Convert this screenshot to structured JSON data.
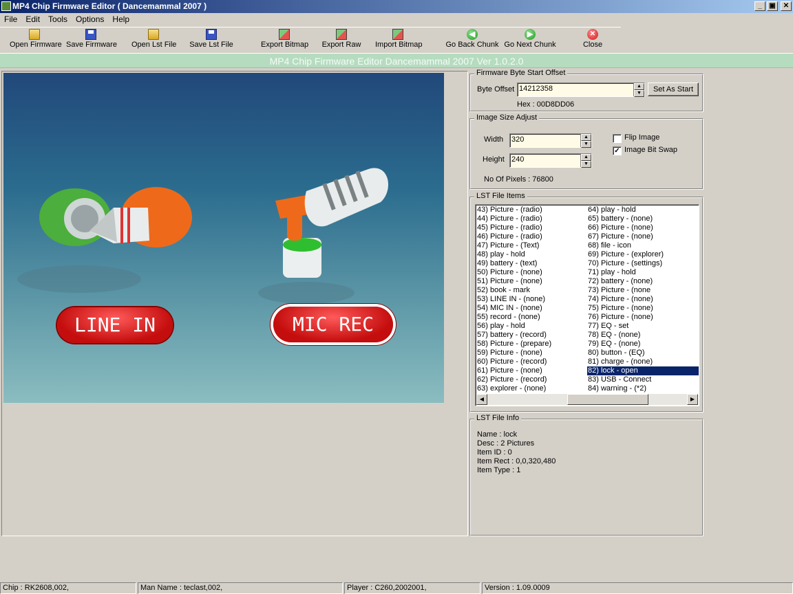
{
  "window": {
    "title": "MP4 Chip Firmware Editor ( Dancemammal 2007 )",
    "min": "_",
    "max": "▣",
    "close": "✕"
  },
  "menu": [
    "File",
    "Edit",
    "Tools",
    "Options",
    "Help"
  ],
  "toolbar": {
    "open_firmware": "Open Firmware",
    "save_firmware": "Save Firmware",
    "open_lst": "Open Lst File",
    "save_lst": "Save Lst File",
    "export_bitmap": "Export Bitmap",
    "export_raw": "Export Raw",
    "import_bitmap": "Import Bitmap",
    "go_back": "Go Back Chunk",
    "go_next": "Go Next Chunk",
    "close": "Close"
  },
  "banner": "MP4 Chip Firmware Editor Dancemammal 2007 Ver 1.0.2.0",
  "preview": {
    "line_in": "LINE IN",
    "mic_rec": "MIC REC"
  },
  "offset_group": {
    "title": "Firmware Byte Start Offset",
    "label": "Byte Offset",
    "value": "14212358",
    "set_button": "Set As Start",
    "hex": "Hex : 00D8DD06"
  },
  "size_group": {
    "title": "Image Size Adjust",
    "width_label": "Width",
    "width_value": "320",
    "height_label": "Height",
    "height_value": "240",
    "pixels": "No Of Pixels : 76800",
    "flip_label": "Flip Image",
    "flip_checked": false,
    "swap_label": "Image Bit Swap",
    "swap_checked": true
  },
  "lst_items": {
    "title": "LST File Items",
    "col1": [
      "43)  Picture - (radio)",
      "44)  Picture - (radio)",
      "45)  Picture - (radio)",
      "46)  Picture - (radio)",
      "47)  Picture - (Text)",
      "48)  play - hold",
      "49)  battery - (text)",
      "50)  Picture - (none)",
      "51)  Picture - (none)",
      "52)  book - mark",
      "53)  LINE IN - (none)",
      "54)  MIC IN - (none)",
      "55)  record - (none)",
      "56)  play - hold",
      "57)  battery - (record)",
      "58)  Picture - (prepare)",
      "59)  Picture - (none)",
      "60)  Picture - (record)",
      "61)  Picture - (none)",
      "62)  Picture - (record)",
      "63)  explorer - (none)"
    ],
    "col2": [
      "64)  play - hold",
      "65)  battery - (none)",
      "66)  Picture - (none)",
      "67)  Picture - (none)",
      "68)  file - icon",
      "69)  Picture - (explorer)",
      "70)  Picture - (settings)",
      "71)  play - hold",
      "72)  battery - (none)",
      "73)  Picture - (none",
      "74)  Picture - (none)",
      "75)  Picture - (none)",
      "76)  Picture - (none)",
      "77)  EQ - set",
      "78)  EQ - (none)",
      "79)  EQ - (none)",
      "80)  button - (EQ)",
      "81)  charge - (none)",
      "82)  lock - open",
      "83)  USB - Connect",
      "84)  warning - (*2)"
    ],
    "selected": "82)  lock - open"
  },
  "lst_info": {
    "title": "LST File Info",
    "name": "Name : lock",
    "desc": "Desc : 2 Pictures",
    "item_id": "Item ID : 0",
    "item_rect": "Item Rect : 0,0,320,480",
    "item_type": "Item Type : 1"
  },
  "status": {
    "chip": "Chip : RK2608,002,",
    "man": "Man Name : teclast,002,",
    "player": "Player : C260,2002001,",
    "version": "Version : 1.09.0009"
  }
}
